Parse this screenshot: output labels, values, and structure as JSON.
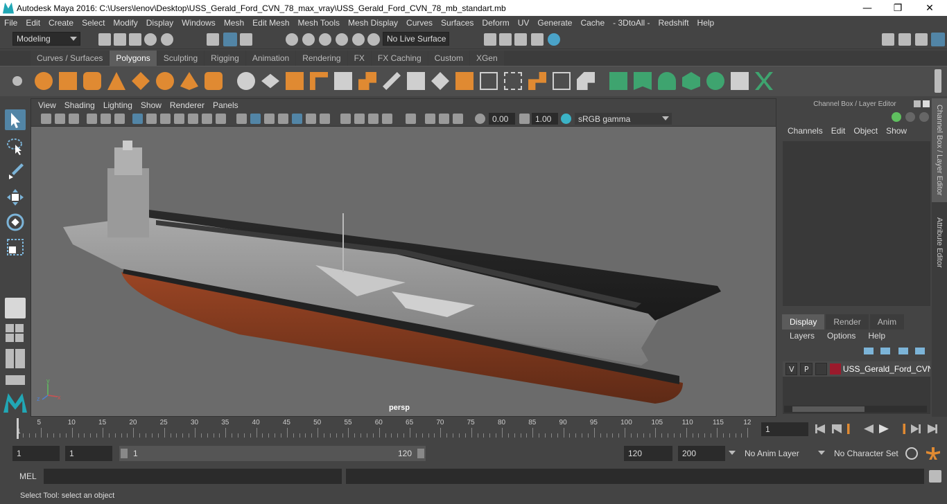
{
  "window": {
    "title": "Autodesk Maya 2016: C:\\Users\\lenov\\Desktop\\USS_Gerald_Ford_CVN_78_max_vray\\USS_Gerald_Ford_CVN_78_mb_standart.mb",
    "minimize": "—",
    "maximize": "❐",
    "close": "✕"
  },
  "menubar": [
    "File",
    "Edit",
    "Create",
    "Select",
    "Modify",
    "Display",
    "Windows",
    "Mesh",
    "Edit Mesh",
    "Mesh Tools",
    "Mesh Display",
    "Curves",
    "Surfaces",
    "Deform",
    "UV",
    "Generate",
    "Cache",
    "- 3DtoAll -",
    "Redshift",
    "Help"
  ],
  "statusline": {
    "mode": "Modeling",
    "live_surface": "No Live Surface"
  },
  "shelf_tabs": [
    "Curves / Surfaces",
    "Polygons",
    "Sculpting",
    "Rigging",
    "Animation",
    "Rendering",
    "FX",
    "FX Caching",
    "Custom",
    "XGen"
  ],
  "active_shelf": "Polygons",
  "viewport": {
    "menu": [
      "View",
      "Shading",
      "Lighting",
      "Show",
      "Renderer",
      "Panels"
    ],
    "exposure": "0.00",
    "gamma": "1.00",
    "color_space": "sRGB gamma",
    "camera": "persp",
    "axis_x": "x",
    "axis_y": "y",
    "axis_z": "z"
  },
  "channel_box": {
    "title": "Channel Box / Layer Editor",
    "menu": [
      "Channels",
      "Edit",
      "Object",
      "Show"
    ]
  },
  "layer_editor": {
    "tabs": [
      "Display",
      "Render",
      "Anim"
    ],
    "active_tab": "Display",
    "menu": [
      "Layers",
      "Options",
      "Help"
    ],
    "layer": {
      "v": "V",
      "p": "P",
      "name": "USS_Gerald_Ford_CVN",
      "color": "#9b1a2c"
    }
  },
  "side_tabs": [
    "Channel Box / Layer Editor",
    "Attribute Editor"
  ],
  "timeline": {
    "ticks": [
      "5",
      "10",
      "15",
      "20",
      "25",
      "30",
      "35",
      "40",
      "45",
      "50",
      "55",
      "60",
      "65",
      "70",
      "75",
      "80",
      "85",
      "90",
      "95",
      "100",
      "105",
      "110",
      "115",
      "12"
    ],
    "start_label": "1",
    "current_frame": "1"
  },
  "range": {
    "start": "1",
    "playback_start": "1",
    "slider_start": "1",
    "slider_end": "120",
    "playback_end": "120",
    "end": "200",
    "anim_layer": "No Anim Layer",
    "character_set": "No Character Set"
  },
  "cmdline": {
    "label": "MEL"
  },
  "help": "Select Tool: select an object",
  "colors": {
    "accent": "#5285a6",
    "shelf_orange": "#e08a32",
    "shelf_green": "#3ea46f",
    "hull_red": "#8a3a20"
  }
}
